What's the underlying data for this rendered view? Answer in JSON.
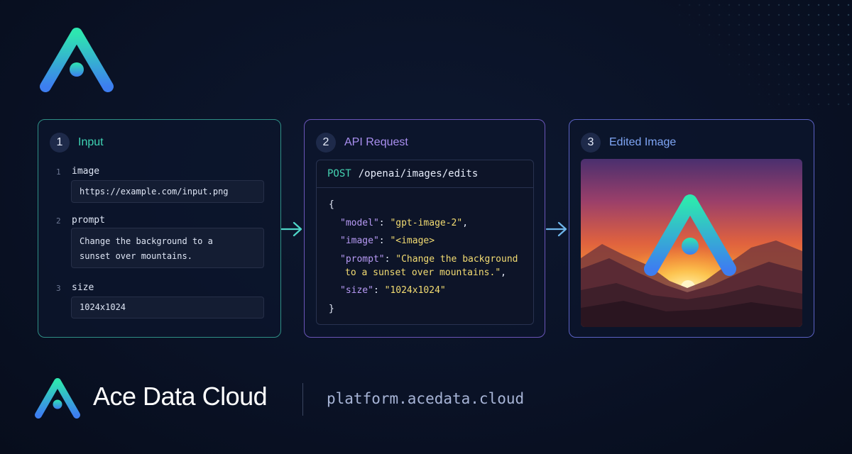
{
  "panels": {
    "input": {
      "number": "1",
      "title": "Input",
      "fields": [
        {
          "num": "1",
          "label": "image",
          "value": "https://example.com/input.png"
        },
        {
          "num": "2",
          "label": "prompt",
          "value_lines": [
            "Change the background to a",
            "sunset over mountains."
          ]
        },
        {
          "num": "3",
          "label": "size",
          "value": "1024x1024"
        }
      ]
    },
    "request": {
      "number": "2",
      "title": "API Request",
      "method": "POST",
      "path": "/openai/images/edits",
      "body": {
        "open_brace": "{",
        "model_key": "\"model\"",
        "model_value": "\"gpt-image-2\"",
        "image_key": "\"image\"",
        "image_value": "\"<image>",
        "prompt_key": "\"prompt\"",
        "prompt_value_line1": "\"Change the background",
        "prompt_value_line2": "to a sunset over mountains.\"",
        "size_key": "\"size\"",
        "size_value": "\"1024x1024\"",
        "close_brace": "}"
      }
    },
    "output": {
      "number": "3",
      "title": "Edited Image"
    }
  },
  "brand": {
    "name": "Ace Data Cloud",
    "url": "platform.acedata.cloud"
  },
  "colors": {
    "input_accent": "#3fd4b4",
    "request_accent": "#a98ff0",
    "output_accent": "#7fa6f5",
    "method": "#45d3b2",
    "json_key": "#b79af5",
    "json_string": "#f3dc72"
  },
  "icons": [
    "ace-logo-icon",
    "arrow-right-icon"
  ]
}
